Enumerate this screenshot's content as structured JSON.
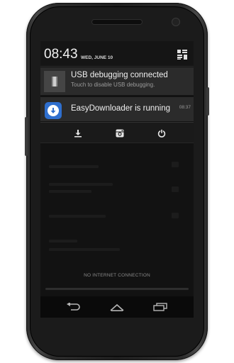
{
  "status_bar": {
    "time": "08:43",
    "date": "WED, JUNE 10"
  },
  "notifications": [
    {
      "title": "USB debugging connected",
      "text": "Touch to disable USB debugging.",
      "icon": "usb-icon"
    },
    {
      "title": "EasyDownloader is running",
      "time": "08:37",
      "icon": "download-app-icon"
    }
  ],
  "actions": [
    {
      "icon": "download-icon"
    },
    {
      "icon": "instagram-icon"
    },
    {
      "icon": "power-icon"
    }
  ],
  "footer": {
    "connection_status": "NO INTERNET CONNECTION"
  },
  "navbar": [
    {
      "icon": "back-icon"
    },
    {
      "icon": "home-icon"
    },
    {
      "icon": "recents-icon"
    }
  ],
  "colors": {
    "accent": "#2f6fce",
    "notification_bg": "#2b2b2b",
    "screen_bg": "#121212"
  }
}
